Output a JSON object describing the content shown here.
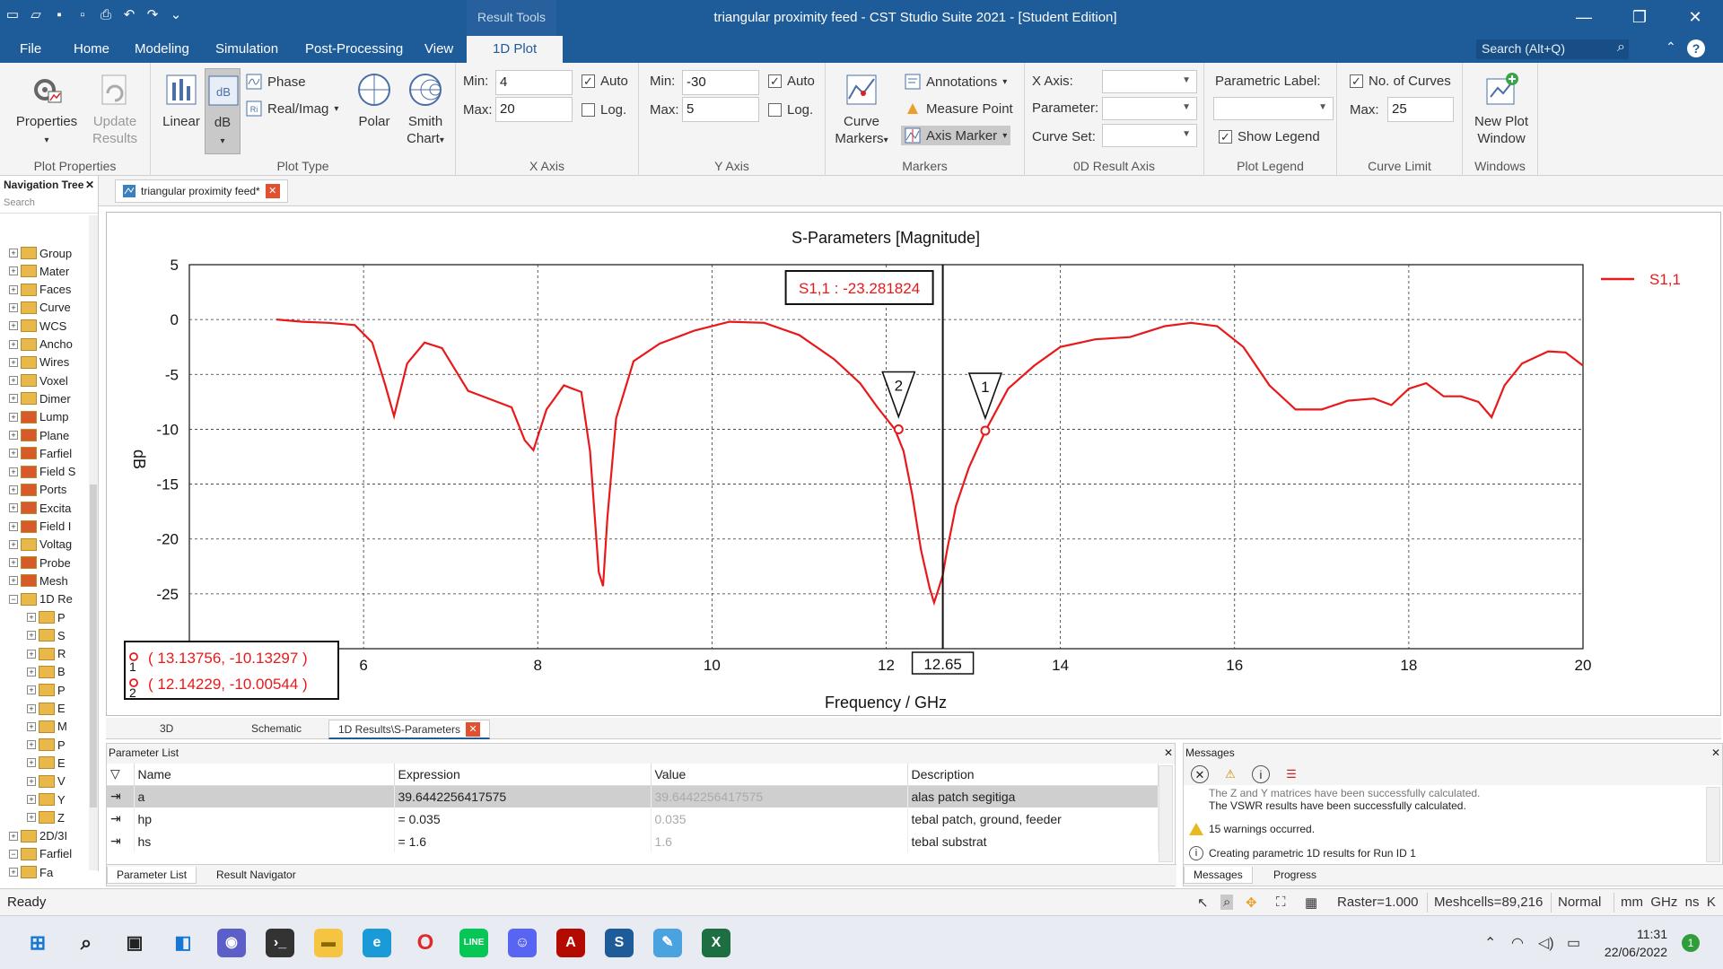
{
  "titlebar": {
    "context_tab": "Result Tools",
    "title": "triangular proximity feed - CST Studio Suite 2021 - [Student Edition]"
  },
  "menu": {
    "items": [
      "File",
      "Home",
      "Modeling",
      "Simulation",
      "Post-Processing",
      "View"
    ],
    "selected": "1D Plot",
    "search_placeholder": "Search (Alt+Q)"
  },
  "ribbon": {
    "plot_properties": {
      "group": "Plot Properties",
      "properties": "Properties",
      "update_results": "Update Results"
    },
    "plot_type": {
      "group": "Plot Type",
      "linear": "Linear",
      "db": "dB",
      "phase": "Phase",
      "real_imag": "Real/Imag",
      "polar": "Polar",
      "smith": "Smith Chart"
    },
    "x_axis": {
      "group": "X Axis",
      "min_label": "Min:",
      "min": "4",
      "max_label": "Max:",
      "max": "20",
      "auto": "Auto",
      "auto_checked": true,
      "log": "Log.",
      "log_checked": false
    },
    "y_axis": {
      "group": "Y Axis",
      "min_label": "Min:",
      "min": "-30",
      "max_label": "Max:",
      "max": "5",
      "auto": "Auto",
      "auto_checked": true,
      "log": "Log.",
      "log_checked": false
    },
    "markers": {
      "group": "Markers",
      "curve_markers": "Curve Markers",
      "annotations": "Annotations",
      "measure_point": "Measure Point",
      "axis_marker": "Axis Marker"
    },
    "od_axis": {
      "group": "0D Result Axis",
      "x_axis": "X Axis:",
      "parameter": "Parameter:",
      "curve_set": "Curve Set:"
    },
    "plot_legend": {
      "group": "Plot Legend",
      "parametric_label": "Parametric Label:",
      "show_legend": "Show Legend",
      "show_legend_checked": true
    },
    "curve_limit": {
      "group": "Curve Limit",
      "no_of_curves": "No. of Curves",
      "checked": true,
      "max_label": "Max:",
      "max": "25"
    },
    "windows": {
      "group": "Windows",
      "new_plot_window": "New Plot Window"
    }
  },
  "navtree": {
    "title": "Navigation Tree",
    "search": "Search",
    "items": [
      {
        "label": "Group",
        "kind": "y"
      },
      {
        "label": "Mater",
        "kind": "y"
      },
      {
        "label": "Faces",
        "kind": "y"
      },
      {
        "label": "Curve",
        "kind": "y"
      },
      {
        "label": "WCS",
        "kind": "y"
      },
      {
        "label": "Ancho",
        "kind": "y"
      },
      {
        "label": "Wires",
        "kind": "y"
      },
      {
        "label": "Voxel",
        "kind": "y"
      },
      {
        "label": "Dimer",
        "kind": "y"
      },
      {
        "label": "Lump",
        "kind": "r"
      },
      {
        "label": "Plane",
        "kind": "r"
      },
      {
        "label": "Farfiel",
        "kind": "r"
      },
      {
        "label": "Field S",
        "kind": "r"
      },
      {
        "label": "Ports",
        "kind": "r"
      },
      {
        "label": "Excita",
        "kind": "r"
      },
      {
        "label": "Field I",
        "kind": "r"
      },
      {
        "label": "Voltag",
        "kind": "y"
      },
      {
        "label": "Probe",
        "kind": "r"
      },
      {
        "label": "Mesh",
        "kind": "r"
      },
      {
        "label": "1D Re",
        "kind": "y"
      },
      {
        "label": "P",
        "kind": "y"
      },
      {
        "label": "S",
        "kind": "y"
      },
      {
        "label": "R",
        "kind": "y"
      },
      {
        "label": "B",
        "kind": "y"
      },
      {
        "label": "P",
        "kind": "y"
      },
      {
        "label": "E",
        "kind": "y"
      },
      {
        "label": "M",
        "kind": "y"
      },
      {
        "label": "P",
        "kind": "y"
      },
      {
        "label": "E",
        "kind": "y"
      },
      {
        "label": "V",
        "kind": "y"
      },
      {
        "label": "Y",
        "kind": "y"
      },
      {
        "label": "Z",
        "kind": "y"
      },
      {
        "label": "2D/3I",
        "kind": "y"
      },
      {
        "label": "Farfiel",
        "kind": "y"
      },
      {
        "label": "Fa",
        "kind": "y"
      }
    ]
  },
  "doc_tab": "triangular proximity feed*",
  "chart_data": {
    "type": "line",
    "title": "S-Parameters [Magnitude]",
    "xlabel": "Frequency / GHz",
    "ylabel": "dB",
    "xlim": [
      4,
      20
    ],
    "ylim": [
      -30,
      5
    ],
    "x_ticks": [
      "6",
      "8",
      "10",
      "12",
      "14",
      "16",
      "18",
      "20"
    ],
    "y_ticks": [
      "5",
      "0",
      "-5",
      "-10",
      "-15",
      "-20",
      "-25",
      "-30"
    ],
    "axis_marker_x": 12.65,
    "axis_marker_label": "12.65",
    "axis_marker_readout": "S1,1 : -23.281824",
    "legend": "S1,1",
    "color": "#e8191b",
    "series": [
      {
        "name": "S1,1",
        "x": [
          5,
          5.3,
          5.6,
          5.9,
          6.1,
          6.25,
          6.35,
          6.5,
          6.7,
          6.9,
          7.2,
          7.5,
          7.7,
          7.85,
          7.95,
          8.1,
          8.3,
          8.5,
          8.6,
          8.7,
          8.75,
          8.8,
          8.9,
          9.1,
          9.4,
          9.8,
          10.2,
          10.6,
          11.0,
          11.4,
          11.7,
          11.9,
          12.1,
          12.2,
          12.3,
          12.4,
          12.5,
          12.55,
          12.6,
          12.65,
          12.7,
          12.8,
          12.95,
          13.14,
          13.4,
          13.7,
          14.0,
          14.4,
          14.8,
          15.2,
          15.5,
          15.8,
          16.1,
          16.4,
          16.7,
          17.0,
          17.3,
          17.6,
          17.8,
          18.0,
          18.2,
          18.4,
          18.6,
          18.8,
          18.95,
          19.1,
          19.3,
          19.6,
          19.8,
          20.0
        ],
        "y": [
          0,
          -0.2,
          -0.3,
          -0.5,
          -2.1,
          -6,
          -8.8,
          -4,
          -2.1,
          -2.6,
          -6.5,
          -7.4,
          -8,
          -11,
          -11.9,
          -8.2,
          -6,
          -6.6,
          -12,
          -23,
          -24.3,
          -18,
          -9,
          -3.8,
          -2.2,
          -1,
          -0.2,
          -0.3,
          -1.4,
          -3.6,
          -5.8,
          -8,
          -10.01,
          -12,
          -16,
          -21,
          -24.5,
          -25.8,
          -24.6,
          -23.28,
          -21,
          -17,
          -13.5,
          -10.13,
          -6.3,
          -4.2,
          -2.5,
          -1.8,
          -1.6,
          -0.6,
          -0.3,
          -0.6,
          -2.5,
          -6,
          -8.2,
          -8.2,
          -7.4,
          -7.2,
          -7.8,
          -6.3,
          -5.8,
          -7,
          -7,
          -7.5,
          -8.9,
          -6,
          -4,
          -2.9,
          -3,
          -4.2
        ]
      }
    ],
    "curve_markers": [
      {
        "id": "1",
        "x": 13.13756,
        "y": -10.13297,
        "readout": "( 13.13756, -10.13297 )"
      },
      {
        "id": "2",
        "x": 12.14229,
        "y": -10.00544,
        "readout": "( 12.14229, -10.00544 )"
      }
    ]
  },
  "view_tabs": {
    "t3d": "3D",
    "schematic": "Schematic",
    "result": "1D Results\\S-Parameters"
  },
  "params": {
    "title": "Parameter List",
    "columns": [
      "Name",
      "Expression",
      "Value",
      "Description"
    ],
    "rows": [
      {
        "name": "a",
        "expr": "39.6442256417575",
        "value": "39.6442256417575",
        "desc": "alas patch segitiga"
      },
      {
        "name": "hp",
        "expr": "= 0.035",
        "value": "0.035",
        "desc": "tebal patch, ground, feeder"
      },
      {
        "name": "hs",
        "expr": "= 1.6",
        "value": "1.6",
        "desc": "tebal substrat"
      }
    ],
    "tab1": "Parameter List",
    "tab2": "Result Navigator"
  },
  "messages": {
    "title": "Messages",
    "lines": [
      {
        "kind": "none",
        "text": "The Z and Y matrices have been successfully calculated."
      },
      {
        "kind": "none",
        "text": "The VSWR results have been successfully calculated."
      },
      {
        "kind": "warn",
        "text": "15 warnings occurred."
      },
      {
        "kind": "info",
        "text": "Creating parametric 1D results for Run ID 1"
      }
    ],
    "tab1": "Messages",
    "tab2": "Progress"
  },
  "status": {
    "ready": "Ready",
    "raster": "Raster=1.000",
    "meshcells": "Meshcells=89,216",
    "mode": "Normal",
    "units": "mm  GHz  ns  K"
  },
  "taskbar": {
    "time": "11:31",
    "date": "22/06/2022",
    "badge": "1"
  }
}
